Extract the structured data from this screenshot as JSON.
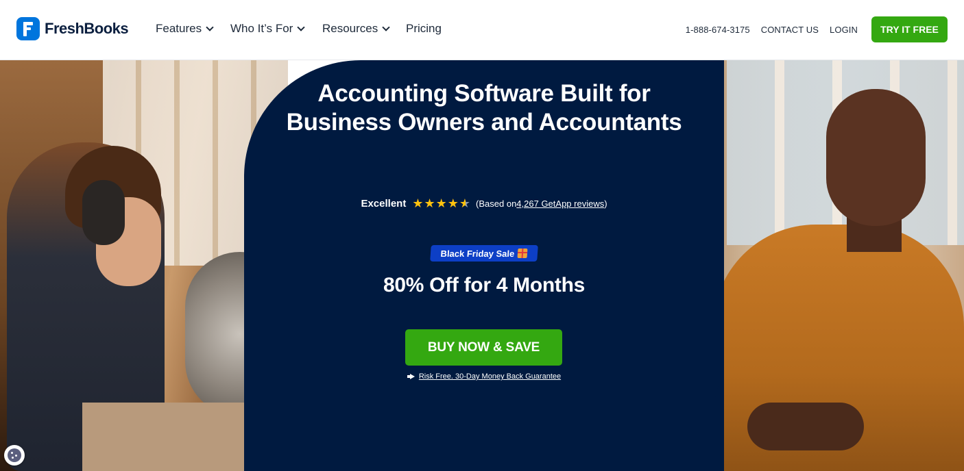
{
  "brand": {
    "name": "FreshBooks",
    "color": "#0075dd"
  },
  "nav": {
    "items": [
      {
        "label": "Features",
        "has_dropdown": true
      },
      {
        "label": "Who It’s For",
        "has_dropdown": true
      },
      {
        "label": "Resources",
        "has_dropdown": true
      },
      {
        "label": "Pricing",
        "has_dropdown": false
      }
    ]
  },
  "header_right": {
    "phone": "1-888-674-3175",
    "contact": "CONTACT US",
    "login": "LOGIN",
    "cta": "TRY IT FREE"
  },
  "hero": {
    "headline": "Accounting Software Built for Business Owners and Accountants",
    "rating": {
      "label": "Excellent",
      "stars": 4.5,
      "based_on_prefix": "(Based on ",
      "reviews_link": "4,267 GetApp reviews",
      "based_on_suffix": ")"
    },
    "sale_badge": "Black Friday Sale",
    "offer": "80% Off for 4 Months",
    "cta": "BUY NOW & SAVE",
    "guarantee": "Risk Free. 30-Day Money Back Guarantee"
  },
  "colors": {
    "navy": "#001a40",
    "green": "#34a811",
    "badge_blue": "#0d3fc6",
    "star": "#ffc20e"
  },
  "icons": [
    "chevron-down-icon",
    "star-icon",
    "gift-icon",
    "megaphone-icon",
    "cookie-icon"
  ]
}
